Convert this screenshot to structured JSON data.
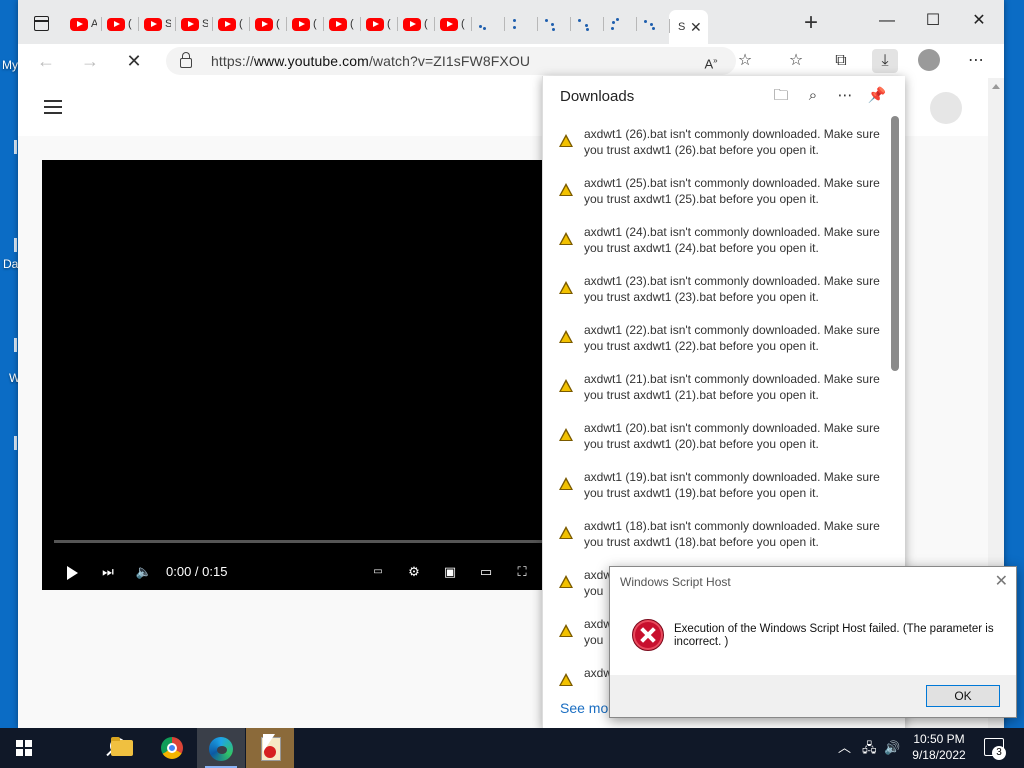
{
  "desktop": {
    "labels": [
      "My",
      "Da",
      "W"
    ]
  },
  "browser": {
    "tab_peek_chars": [
      "A",
      "(",
      "S",
      "S",
      "(",
      "(",
      "(",
      "(",
      "(",
      "(",
      "(",
      "S"
    ],
    "url_prefix": "https://",
    "url_domain": "www.youtube.com",
    "url_path": "/watch?v=ZI1sFW8FXOU",
    "window_minimize": "—",
    "window_maximize": "☐",
    "window_close": "✕"
  },
  "player": {
    "time": "0:00 / 0:15",
    "progress_fraction": 0
  },
  "downloads": {
    "title": "Downloads",
    "see_more": "See mo",
    "items": [
      {
        "text": "axdwt1 (26).bat isn't commonly downloaded. Make sure you trust axdwt1 (26).bat before you open it."
      },
      {
        "text": "axdwt1 (25).bat isn't commonly downloaded. Make sure you trust axdwt1 (25).bat before you open it."
      },
      {
        "text": "axdwt1 (24).bat isn't commonly downloaded. Make sure you trust axdwt1 (24).bat before you open it."
      },
      {
        "text": "axdwt1 (23).bat isn't commonly downloaded. Make sure you trust axdwt1 (23).bat before you open it."
      },
      {
        "text": "axdwt1 (22).bat isn't commonly downloaded. Make sure you trust axdwt1 (22).bat before you open it."
      },
      {
        "text": "axdwt1 (21).bat isn't commonly downloaded. Make sure you trust axdwt1 (21).bat before you open it."
      },
      {
        "text": "axdwt1 (20).bat isn't commonly downloaded. Make sure you trust axdwt1 (20).bat before you open it."
      },
      {
        "text": "axdwt1 (19).bat isn't commonly downloaded. Make sure you trust axdwt1 (19).bat before you open it."
      },
      {
        "text": "axdwt1 (18).bat isn't commonly downloaded. Make sure you trust axdwt1 (18).bat before you open it."
      },
      {
        "text": "axdw you"
      },
      {
        "text": "axdw you"
      },
      {
        "text": "axdw"
      }
    ]
  },
  "dialog": {
    "title": "Windows Script Host",
    "close": "✕",
    "message": "Execution of the Windows Script Host failed. (The parameter is incorrect. )",
    "ok_label": "OK"
  },
  "taskbar": {
    "time": "10:50 PM",
    "date": "9/18/2022",
    "notification_count": "3"
  }
}
